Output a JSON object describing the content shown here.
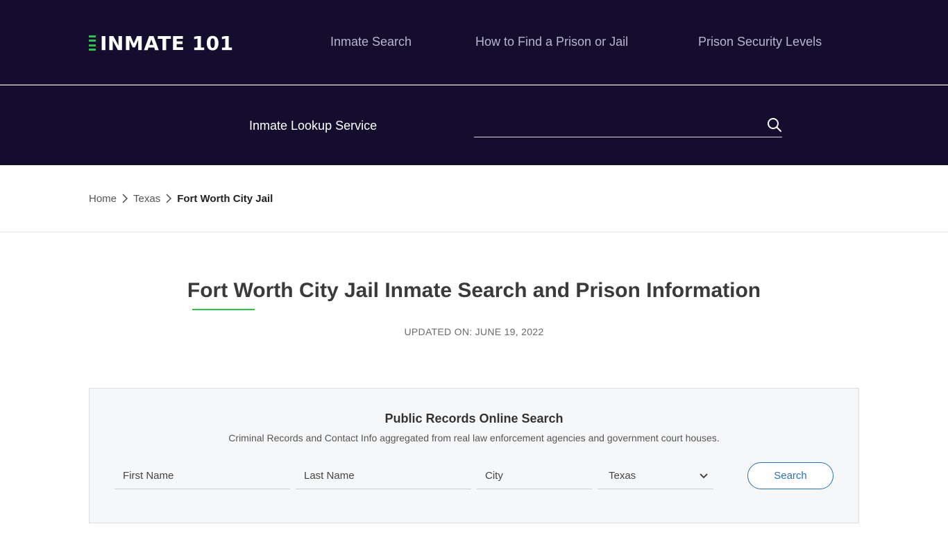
{
  "header": {
    "logo_text": "INMATE 101",
    "nav": [
      {
        "label": "Inmate Search"
      },
      {
        "label": "How to Find a Prison or Jail"
      },
      {
        "label": "Prison Security Levels"
      }
    ]
  },
  "lookup": {
    "label": "Inmate Lookup Service",
    "placeholder": "",
    "icon": "search-icon"
  },
  "breadcrumb": {
    "items": [
      "Home",
      "Texas"
    ],
    "current": "Fort Worth City Jail",
    "separator_icon": "chevron-right-icon"
  },
  "main": {
    "title": "Fort Worth City Jail Inmate Search and Prison Information",
    "updated": "UPDATED ON: JUNE 19, 2022"
  },
  "records": {
    "title": "Public Records Online Search",
    "subtitle": "Criminal Records and Contact Info aggregated from real law enforcement agencies and government court houses.",
    "first_name_placeholder": "First Name",
    "last_name_placeholder": "Last Name",
    "city_placeholder": "City",
    "state_selected": "Texas",
    "search_label": "Search"
  },
  "colors": {
    "header_bg": "#140d2e",
    "accent_green": "#2ec24a",
    "button_blue": "#2d6fb5"
  }
}
